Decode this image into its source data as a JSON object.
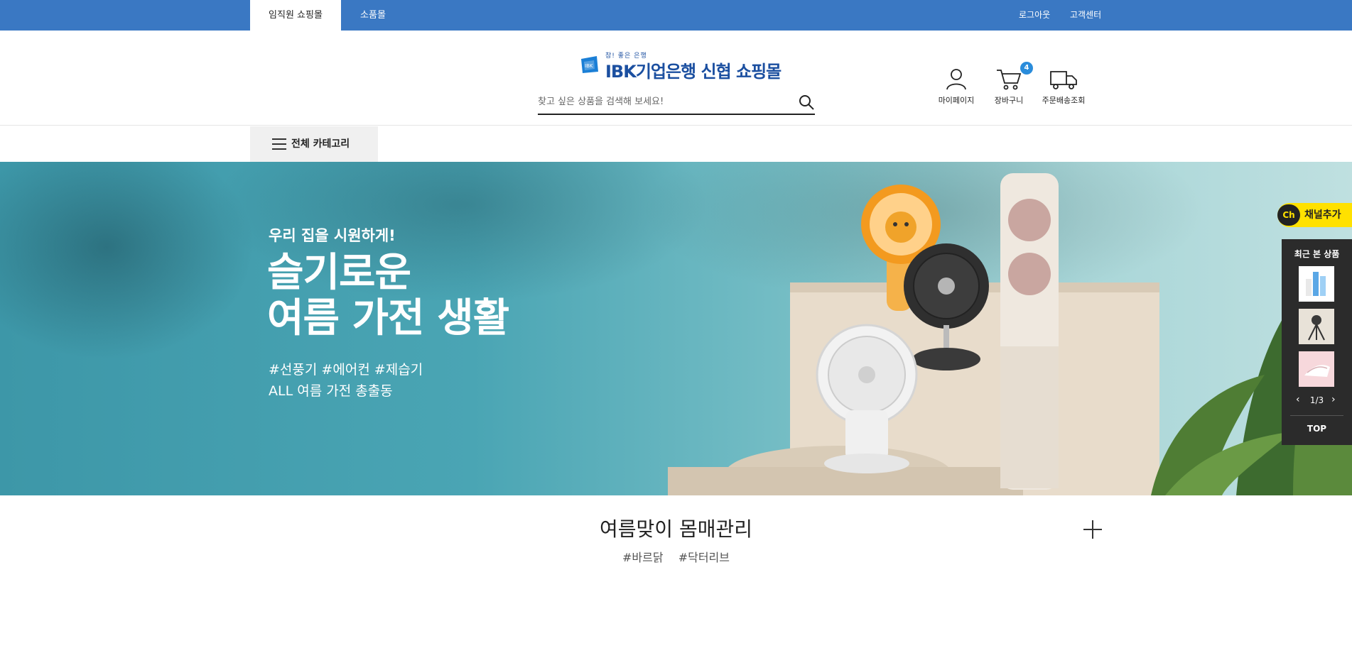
{
  "topbar": {
    "tabs": [
      {
        "label": "임직원 쇼핑몰",
        "active": true
      },
      {
        "label": "소품몰",
        "active": false
      }
    ],
    "logout": "로그아웃",
    "customer_center": "고객센터",
    "color": "#3a78c3"
  },
  "header": {
    "logo_tagline": "참! 좋은 은행",
    "logo_text": "IBK기업은행 신협 쇼핑몰",
    "logo_mark_text": "IBK",
    "search_placeholder": "찾고 싶은 상품을 검색해 보세요!",
    "icons": {
      "mypage": "마이페이지",
      "cart": "장바구니",
      "cart_count": "4",
      "delivery": "주문배송조회"
    }
  },
  "category": {
    "label": "전체 카테고리"
  },
  "banner": {
    "subtitle": "우리 집을 시원하게!",
    "title": "슬기로운\n여름 가전 생활",
    "tags": "#선풍기 #에어컨 #제습기\nALL 여름 가전 총출동"
  },
  "floating": {
    "channel_badge": "Ch",
    "channel_label": "채널추가",
    "recent_title": "최근 본 상품",
    "page": "1/3",
    "prev": "‹",
    "next": "›",
    "top": "TOP"
  },
  "section": {
    "title": "여름맞이 몸매관리",
    "tags": [
      "#바르닭",
      "#닥터리브"
    ]
  }
}
